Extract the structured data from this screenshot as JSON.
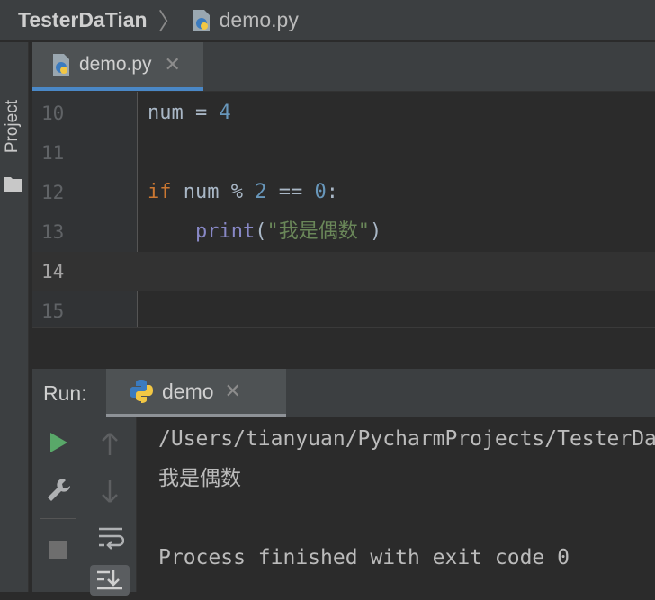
{
  "breadcrumb": {
    "project": "TesterDaTian",
    "file": "demo.py"
  },
  "sidebar": {
    "project_label": "Project"
  },
  "editor_tab": {
    "label": "demo.py",
    "close": "✕"
  },
  "gutter": {
    "lines": [
      "10",
      "11",
      "12",
      "13",
      "14",
      "15"
    ]
  },
  "code": {
    "l10": {
      "var": "num",
      "op": " = ",
      "num": "4"
    },
    "l12": {
      "kw": "if",
      "var": " num % ",
      "num1": "2",
      "op": " == ",
      "num2": "0",
      "colon": ":"
    },
    "l13": {
      "indent": "    ",
      "fn": "print",
      "open": "(",
      "str": "\"我是偶数\"",
      "close": ")"
    }
  },
  "run_panel": {
    "title": "Run:",
    "tab_label": "demo",
    "close": "✕"
  },
  "console": {
    "lines": [
      "/Users/tianyuan/PycharmProjects/TesterDaTian/demo.py",
      "我是偶数",
      "",
      "Process finished with exit code 0"
    ]
  },
  "colors": {
    "accent": "#4a88c7",
    "run_green": "#59a869",
    "keyword": "#cc7832",
    "number": "#6897bb",
    "string": "#6a8759",
    "builtin": "#8888c6"
  },
  "icons": [
    "python-file-icon",
    "folder-icon",
    "play-icon",
    "wrench-icon",
    "stop-icon",
    "arrow-up-icon",
    "arrow-down-icon",
    "soft-wrap-icon",
    "scroll-to-end-icon"
  ]
}
